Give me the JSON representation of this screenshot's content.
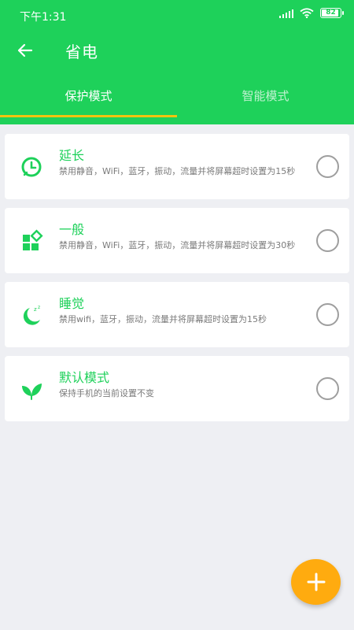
{
  "status_bar": {
    "time": "下午1:31",
    "battery": "82",
    "icons": [
      "signal-icon",
      "wifi-icon",
      "battery-icon"
    ]
  },
  "toolbar": {
    "back_icon": "arrow-left-icon",
    "title": "省电"
  },
  "tabs": [
    {
      "label": "保护模式",
      "active": true
    },
    {
      "label": "智能模式",
      "active": false
    }
  ],
  "modes": [
    {
      "icon": "clock-icon",
      "title": "延长",
      "description": "禁用静音，WiFi，蓝牙，振动，流量并将屏幕超时设置为15秒",
      "selected": false
    },
    {
      "icon": "shapes-icon",
      "title": "一般",
      "description": "禁用静音，WiFi，蓝牙，振动，流量并将屏幕超时设置为30秒",
      "selected": false
    },
    {
      "icon": "moon-sleep-icon",
      "title": "睡觉",
      "description": "禁用wifi，蓝牙，振动，流量并将屏幕超时设置为15秒",
      "selected": false
    },
    {
      "icon": "leaf-icon",
      "title": "默认模式",
      "description": "保持手机的当前设置不变",
      "selected": false
    }
  ],
  "fab": {
    "icon": "plus-icon"
  },
  "colors": {
    "primary": "#1ed15a",
    "tab_indicator": "#f2c40f",
    "fab": "#ffab0f",
    "background": "#eeeff3"
  }
}
